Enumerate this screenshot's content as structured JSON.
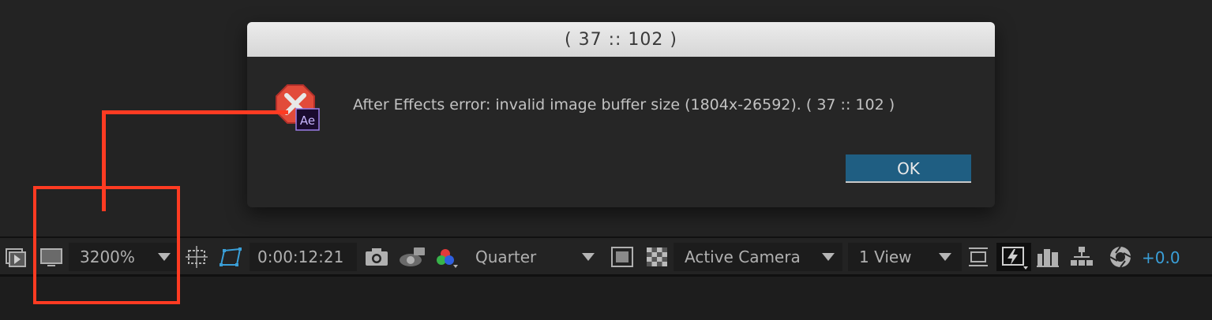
{
  "dialog": {
    "title": "( 37 :: 102 )",
    "message": "After Effects error: invalid image buffer size (1804x-26592). ( 37 :: 102 )",
    "ok_label": "OK",
    "icon_badge": "Ae"
  },
  "toolbar": {
    "zoom": "3200%",
    "timecode": "0:00:12:21",
    "resolution": "Quarter",
    "camera": "Active Camera",
    "views": "1 View",
    "exposure": "+0.0"
  },
  "colors": {
    "accent": "#3a9fd8",
    "ok_button": "#1f5e82",
    "annotation": "#ff3b22"
  }
}
